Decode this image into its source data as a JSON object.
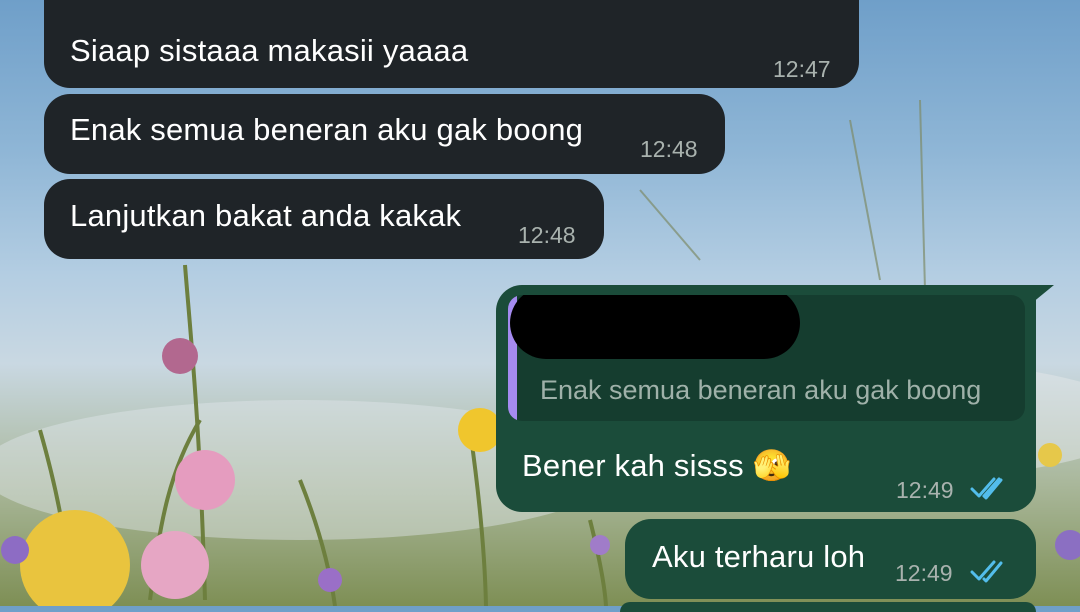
{
  "chat": {
    "messages": [
      {
        "direction": "incoming",
        "text": "Siaap sistaaa makasii yaaaa",
        "time": "12:47"
      },
      {
        "direction": "incoming",
        "text": "Enak semua beneran aku gak boong",
        "time": "12:48"
      },
      {
        "direction": "incoming",
        "text": "Lanjutkan bakat anda kakak",
        "time": "12:48"
      },
      {
        "direction": "outgoing",
        "quoted_text": "Enak semua beneran aku gak boong",
        "text": "Bener kah sisss",
        "emoji": "🫣",
        "time": "12:49",
        "status": "read"
      },
      {
        "direction": "outgoing",
        "text": "Aku terharu loh",
        "time": "12:49",
        "status": "read"
      }
    ]
  },
  "colors": {
    "incoming_bubble": "#1f2428",
    "outgoing_bubble": "#1b4c3a",
    "quote_accent": "#a58bf0",
    "read_ticks": "#53bdeb"
  }
}
